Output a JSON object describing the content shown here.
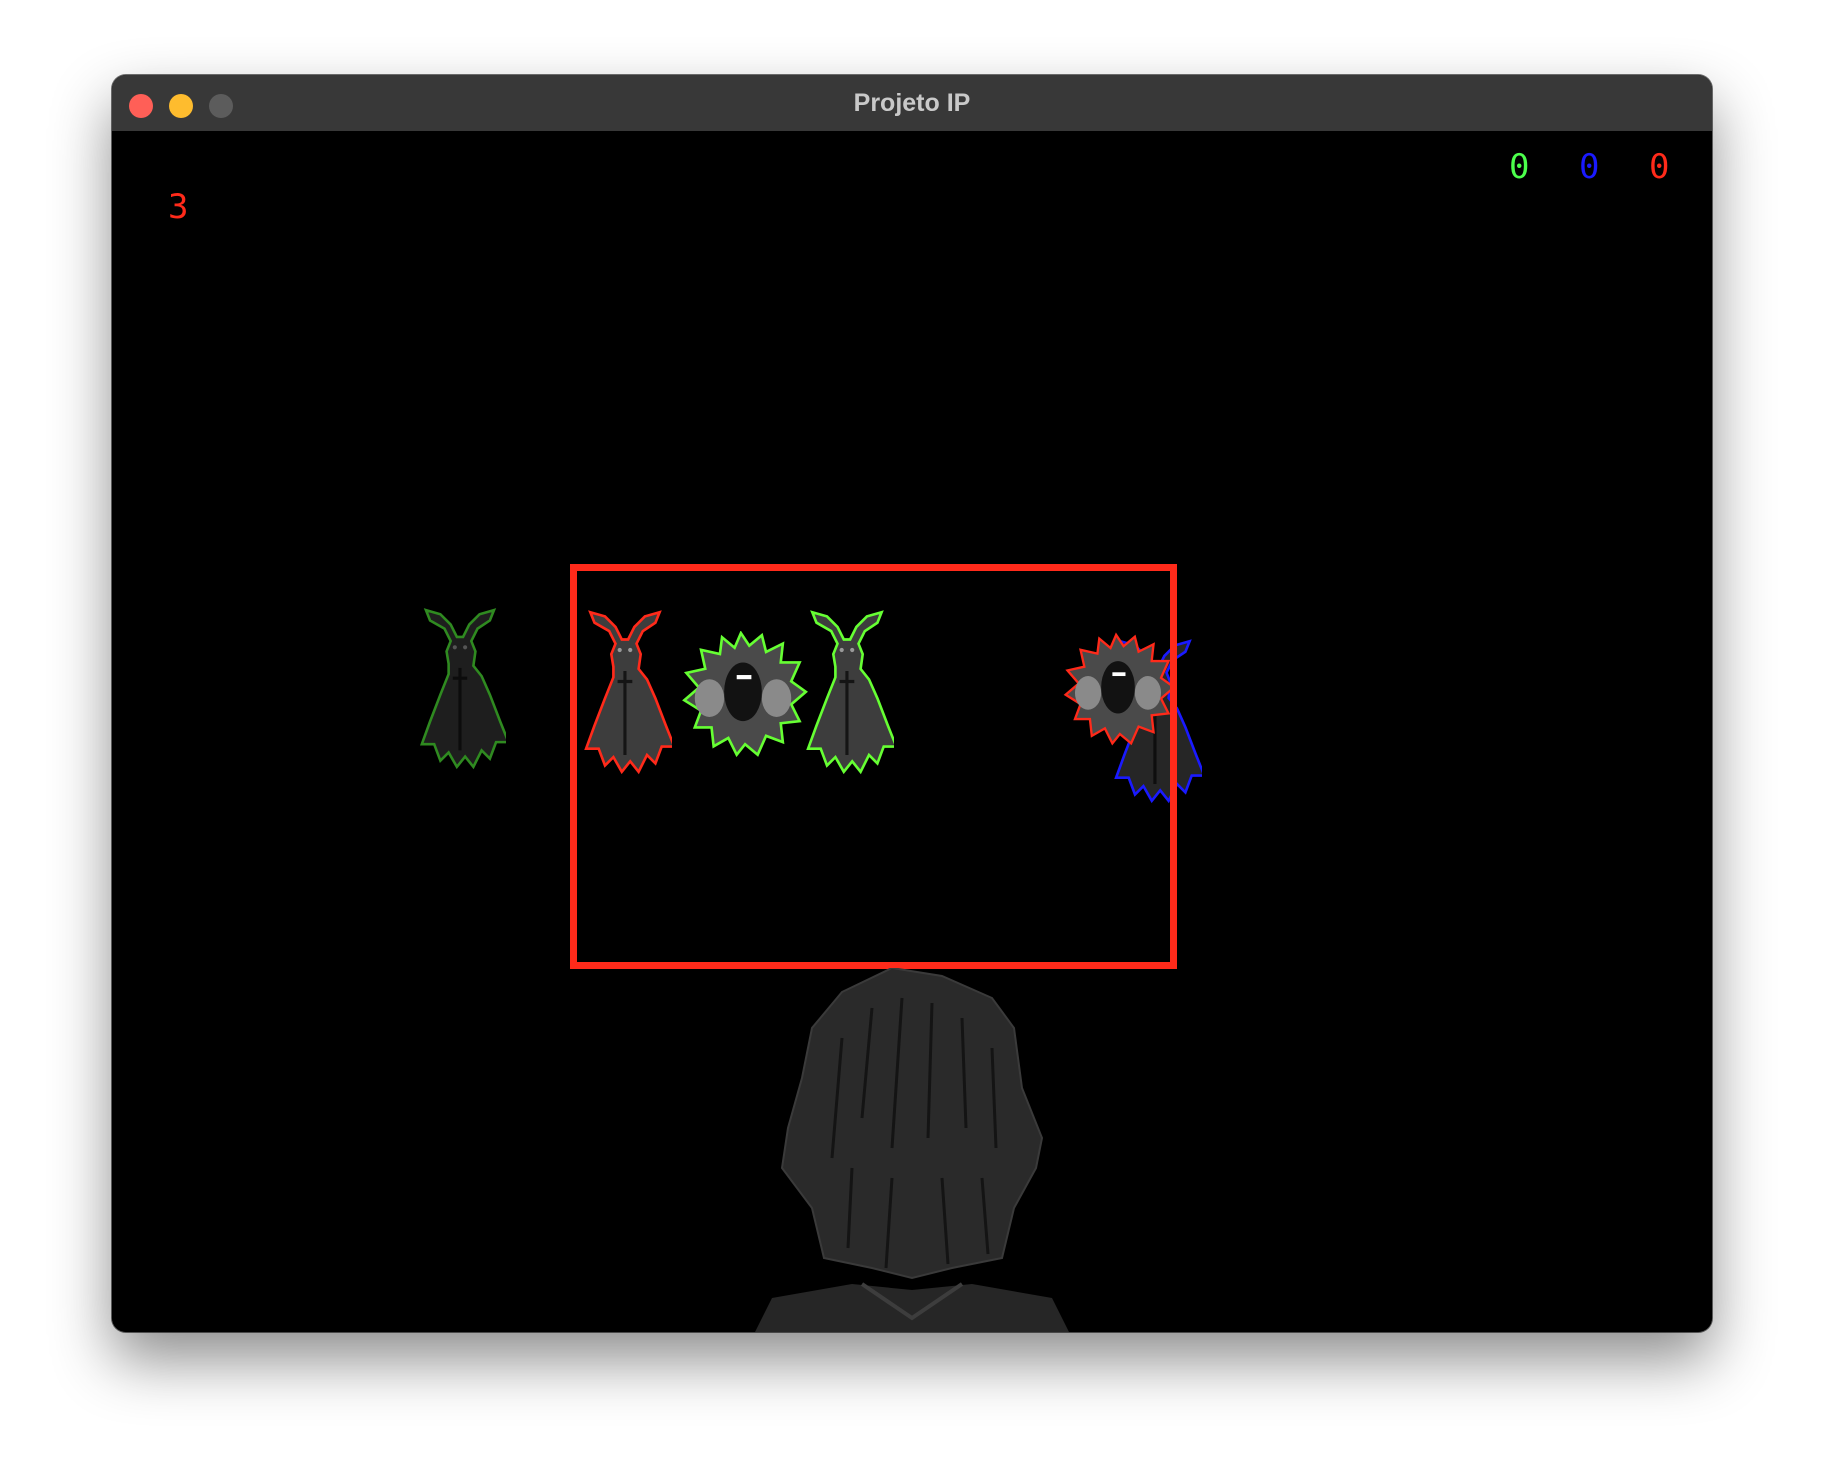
{
  "window": {
    "title": "Projeto IP",
    "controls": {
      "close_color": "#ff5f57",
      "minimize_color": "#febc2e",
      "zoom_color": "#5c5c5c"
    }
  },
  "hud": {
    "lives": "3",
    "lives_color": "#ff2a1a",
    "scores": [
      {
        "label": "0",
        "color": "#4cff4c"
      },
      {
        "label": "0",
        "color": "#1a1aff"
      },
      {
        "label": "0",
        "color": "#ff2a1a"
      }
    ]
  },
  "targeting_box": {
    "color": "#ff2a1a"
  },
  "enemies": [
    {
      "kind": "horned-robed-figure",
      "outline": "#2f8a20"
    },
    {
      "kind": "horned-robed-figure",
      "outline": "#ff2a1a"
    },
    {
      "kind": "moth-creature",
      "outline": "#66ff33"
    },
    {
      "kind": "horned-robed-figure",
      "outline": "#66ff33"
    },
    {
      "kind": "moth-creature",
      "outline": "#ff2a1a"
    },
    {
      "kind": "horned-robed-figure",
      "outline": "#1a1aff"
    }
  ],
  "player": {
    "kind": "dark-haired-head-from-behind"
  }
}
